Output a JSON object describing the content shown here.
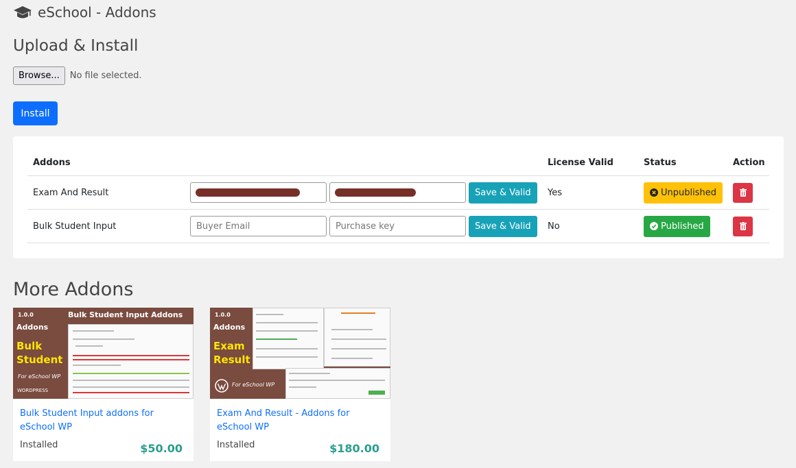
{
  "header": {
    "app_title": "eSchool - Addons",
    "icon": "graduation-cap-icon"
  },
  "upload": {
    "section_title": "Upload & Install",
    "browse_label": "Browse...",
    "file_status": "No file selected.",
    "install_label": "Install"
  },
  "table": {
    "headers": {
      "addons": "Addons",
      "license_valid": "License Valid",
      "status": "Status",
      "action": "Action"
    },
    "rows": [
      {
        "name": "Exam And Result",
        "email_value": "",
        "email_placeholder": "",
        "key_value": "",
        "key_placeholder": "",
        "save_label": "Save & Valid",
        "license_valid": "Yes",
        "status": "Unpublished",
        "status_color": "#ffc107"
      },
      {
        "name": "Bulk Student Input",
        "email_value": "",
        "email_placeholder": "Buyer Email",
        "key_value": "",
        "key_placeholder": "Purchase key",
        "save_label": "Save & Valid",
        "license_valid": "No",
        "status": "Published",
        "status_color": "#28a745"
      }
    ]
  },
  "more": {
    "section_title": "More Addons",
    "cards": [
      {
        "thumb": {
          "version": "1.0.0",
          "addons": "Addons",
          "line1": "Bulk",
          "line2": "Student",
          "for": "For eSchool WP",
          "heading": "Bulk Student Input Addons",
          "brand": "WORDPRESS"
        },
        "title": "Bulk Student Input addons for eSchool WP",
        "installed": "Installed",
        "price": "$50.00"
      },
      {
        "thumb": {
          "version": "1.0.0",
          "addons": "Addons",
          "line1": "Exam",
          "line2": "Result",
          "for": "For eSchool WP",
          "heading": "",
          "brand": ""
        },
        "title": "Exam And Result - Addons for eSchool WP",
        "installed": "Installed",
        "price": "$180.00"
      }
    ]
  },
  "colors": {
    "primary": "#0d6efd",
    "info": "#17a2b8",
    "danger": "#dc3545",
    "price": "#2b9e8e"
  }
}
